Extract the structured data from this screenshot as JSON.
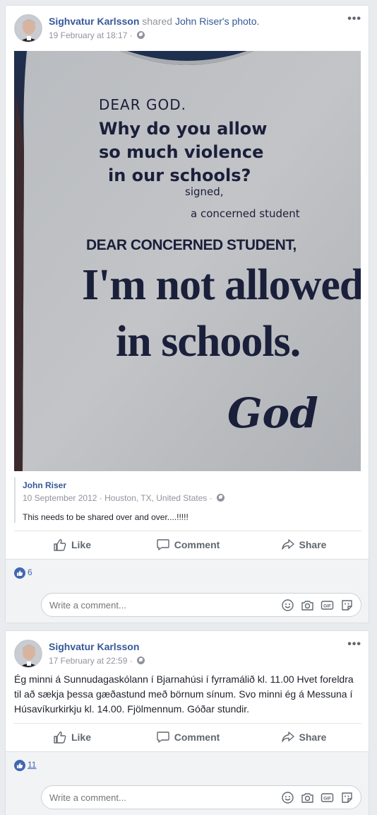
{
  "posts": [
    {
      "author": "Sighvatur Karlsson",
      "shared_word": "shared",
      "shared_target": "John Riser",
      "shared_object": "'s photo.",
      "timestamp": "19 February at 18:17",
      "more_icon": "•••",
      "photo_text": {
        "line1": "DEAR GOD.",
        "line2": "Why do you allow",
        "line3": "so much violence",
        "line4": "in our schools?",
        "line5": "signed,",
        "line6": "a concerned student",
        "line7": "DEAR CONCERNED STUDENT,",
        "line8": "I'm not allowed",
        "line9": "in schools.",
        "line10": "God"
      },
      "original": {
        "author": "John Riser",
        "date": "10 September 2012",
        "separator": "·",
        "location": "Houston, TX, United States",
        "text": "This needs to be shared over and over....!!!!!"
      },
      "actions": {
        "like": "Like",
        "comment": "Comment",
        "share": "Share"
      },
      "like_count": "6",
      "comment_placeholder": "Write a comment..."
    },
    {
      "author": "Sighvatur Karlsson",
      "timestamp": "17 February at 22:59",
      "more_icon": "•••",
      "text": "Ég minni á Sunnudagaskólann í Bjarnahúsi í fyrramálið kl. 11.00 Hvet foreldra til að sækja þessa gæðastund með börnum sínum. Svo minni ég á Messuna í Húsavíkurkirkju kl. 14.00. Fjölmennum. Góðar stundir.",
      "actions": {
        "like": "Like",
        "comment": "Comment",
        "share": "Share"
      },
      "like_count": "11",
      "comment_placeholder": "Write a comment..."
    }
  ],
  "colors": {
    "link": "#365899",
    "muted": "#90949c",
    "accent": "#4267b2",
    "background": "#e9ebee"
  }
}
